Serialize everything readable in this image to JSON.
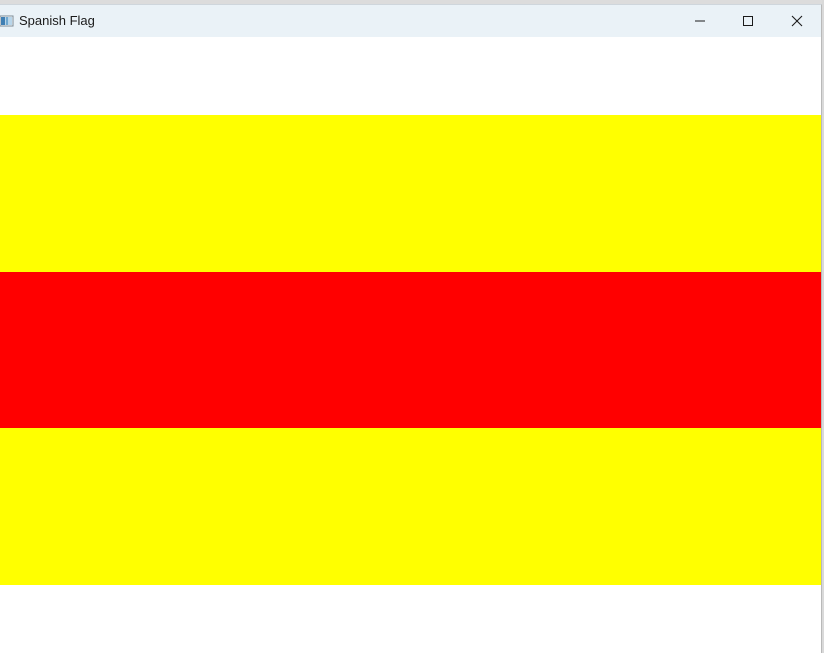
{
  "window": {
    "title": "Spanish Flag",
    "controls": {
      "minimize_icon": "minimize-icon",
      "maximize_icon": "maximize-icon",
      "close_icon": "close-icon"
    }
  },
  "colors": {
    "titlebar": "#eaf2f7",
    "background": "#ffffff",
    "yellow": "#ffff00",
    "red": "#ff0000"
  },
  "flag": {
    "stripes": [
      "yellow",
      "red",
      "yellow"
    ]
  }
}
